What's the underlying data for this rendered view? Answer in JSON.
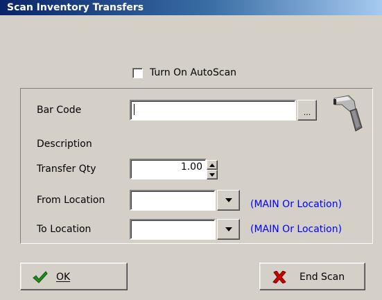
{
  "window": {
    "title": "Scan Inventory Transfers"
  },
  "autoscan": {
    "label": "Turn On AutoScan",
    "checked": false
  },
  "form": {
    "barcode_label": "Bar Code",
    "barcode_value": "",
    "browse_label": "...",
    "description_label": "Description",
    "qty_label": "Transfer Qty",
    "qty_value": "1.00",
    "from_label": "From Location",
    "from_value": "",
    "from_hint": "(MAIN Or Location)",
    "to_label": "To Location",
    "to_value": "",
    "to_hint": "(MAIN Or Location)"
  },
  "buttons": {
    "ok_label": "OK",
    "end_label": "End Scan"
  },
  "icons": {
    "scanner": "barcode-scanner-icon",
    "ok": "checkmark-icon",
    "end": "red-x-icon",
    "dropdown": "triangle-down-icon",
    "spin_up": "triangle-up-icon",
    "spin_down": "triangle-down-icon"
  },
  "colors": {
    "title_bar_start": "#0a246a",
    "title_bar_end": "#a6caf0",
    "hint": "#0000ff",
    "ok_icon": "#1e8c1e",
    "end_icon": "#cc0000",
    "face": "#d4d0c8"
  }
}
